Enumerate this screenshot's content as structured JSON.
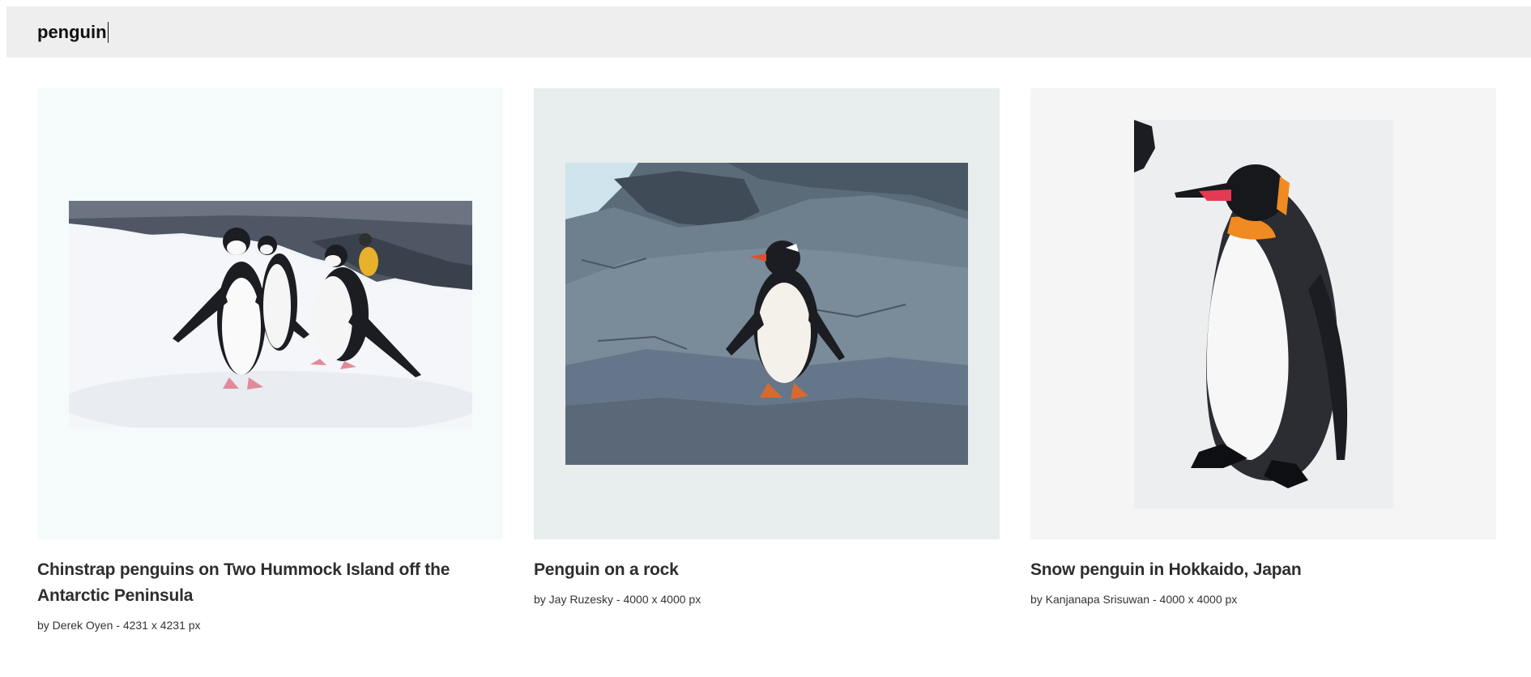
{
  "search": {
    "value": "penguin"
  },
  "results": [
    {
      "title": "Chinstrap penguins on Two Hummock Island off the Antarctic Peninsula",
      "meta": "by Derek Oyen - 4231 x 4231 px",
      "frame_color": "#f5fbfb"
    },
    {
      "title": "Penguin on a rock",
      "meta": "by Jay Ruzesky - 4000 x 4000 px",
      "frame_color": "#e8eded"
    },
    {
      "title": "Snow penguin in Hokkaido, Japan",
      "meta": "by Kanjanapa Srisuwan - 4000 x 4000 px",
      "frame_color": "#f5f5f5"
    }
  ]
}
